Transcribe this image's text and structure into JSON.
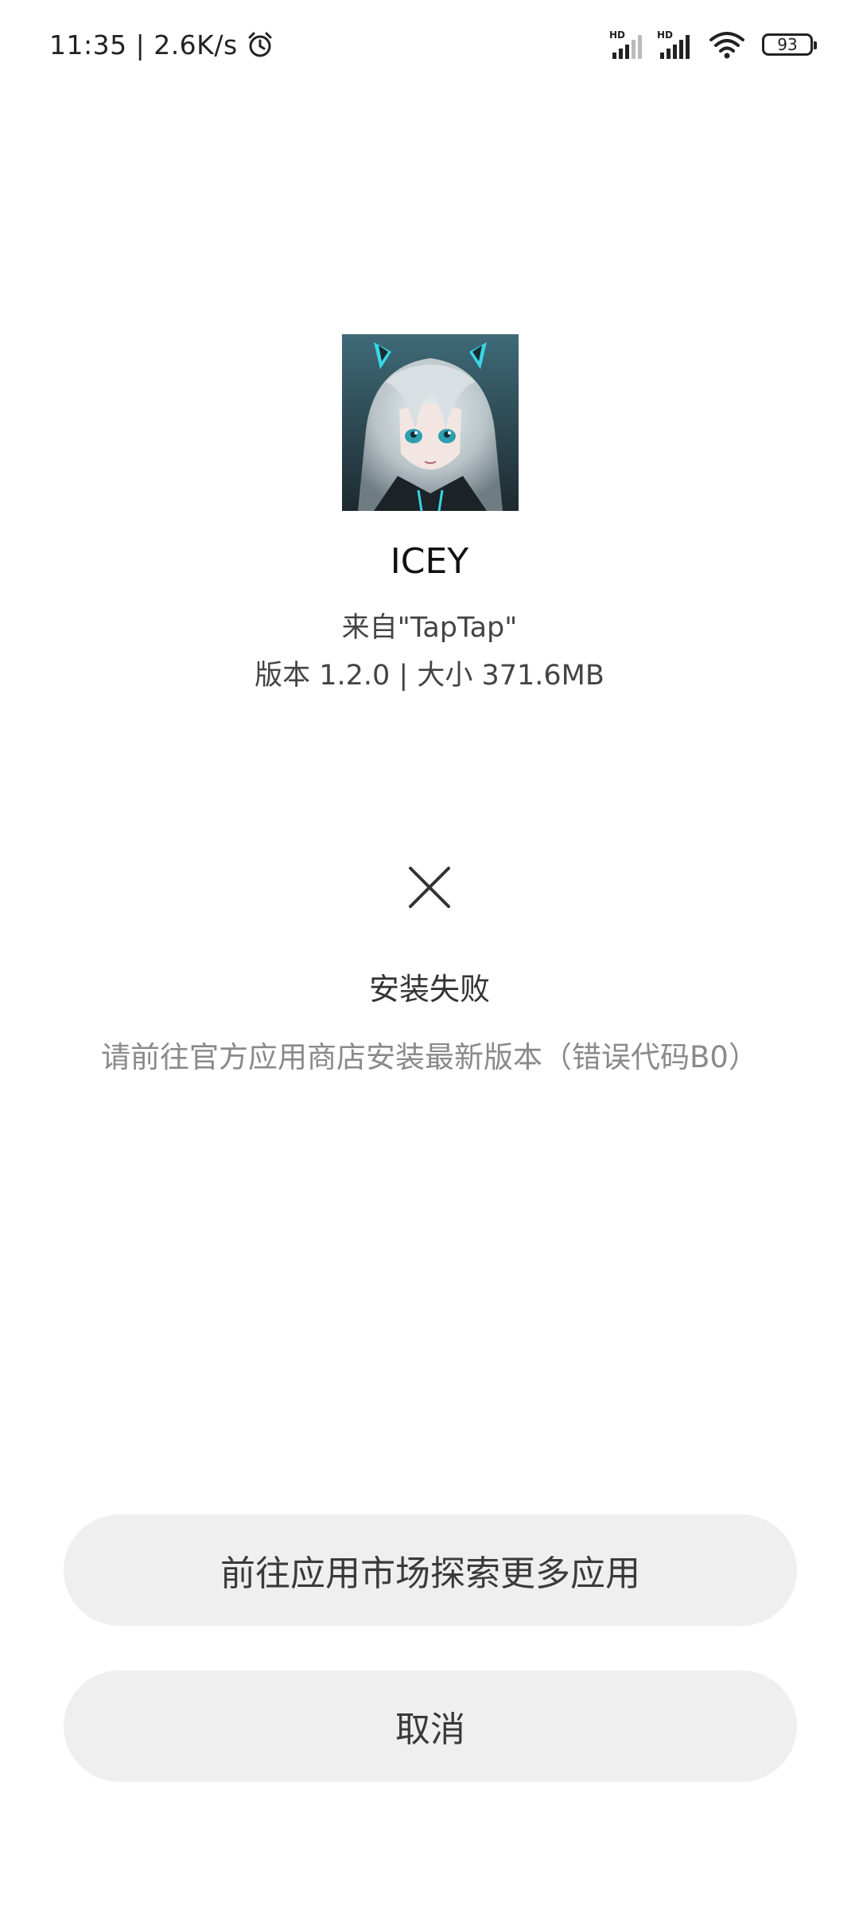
{
  "status_bar": {
    "time_speed": "11:35 | 2.6K/s",
    "signal1_label": "HD",
    "signal2_label": "HD",
    "battery_level": "93",
    "icons": [
      "alarm-icon",
      "signal-hd-icon",
      "signal-hd-icon",
      "wifi-icon",
      "battery-icon"
    ]
  },
  "app": {
    "name": "ICEY",
    "source": "来自\"TapTap\"",
    "meta": "版本 1.2.0 | 大小 371.6MB",
    "icon": "app-icon-icey"
  },
  "result": {
    "icon": "close-icon",
    "title": "安装失败",
    "description": "请前往官方应用商店安装最新版本（错误代码B0）"
  },
  "actions": {
    "market_label": "前往应用市场探索更多应用",
    "cancel_label": "取消"
  },
  "colors": {
    "background": "#ffffff",
    "button_bg": "#efefef",
    "button_text": "#3a3a3a",
    "secondary_text": "#8a8a8a"
  }
}
